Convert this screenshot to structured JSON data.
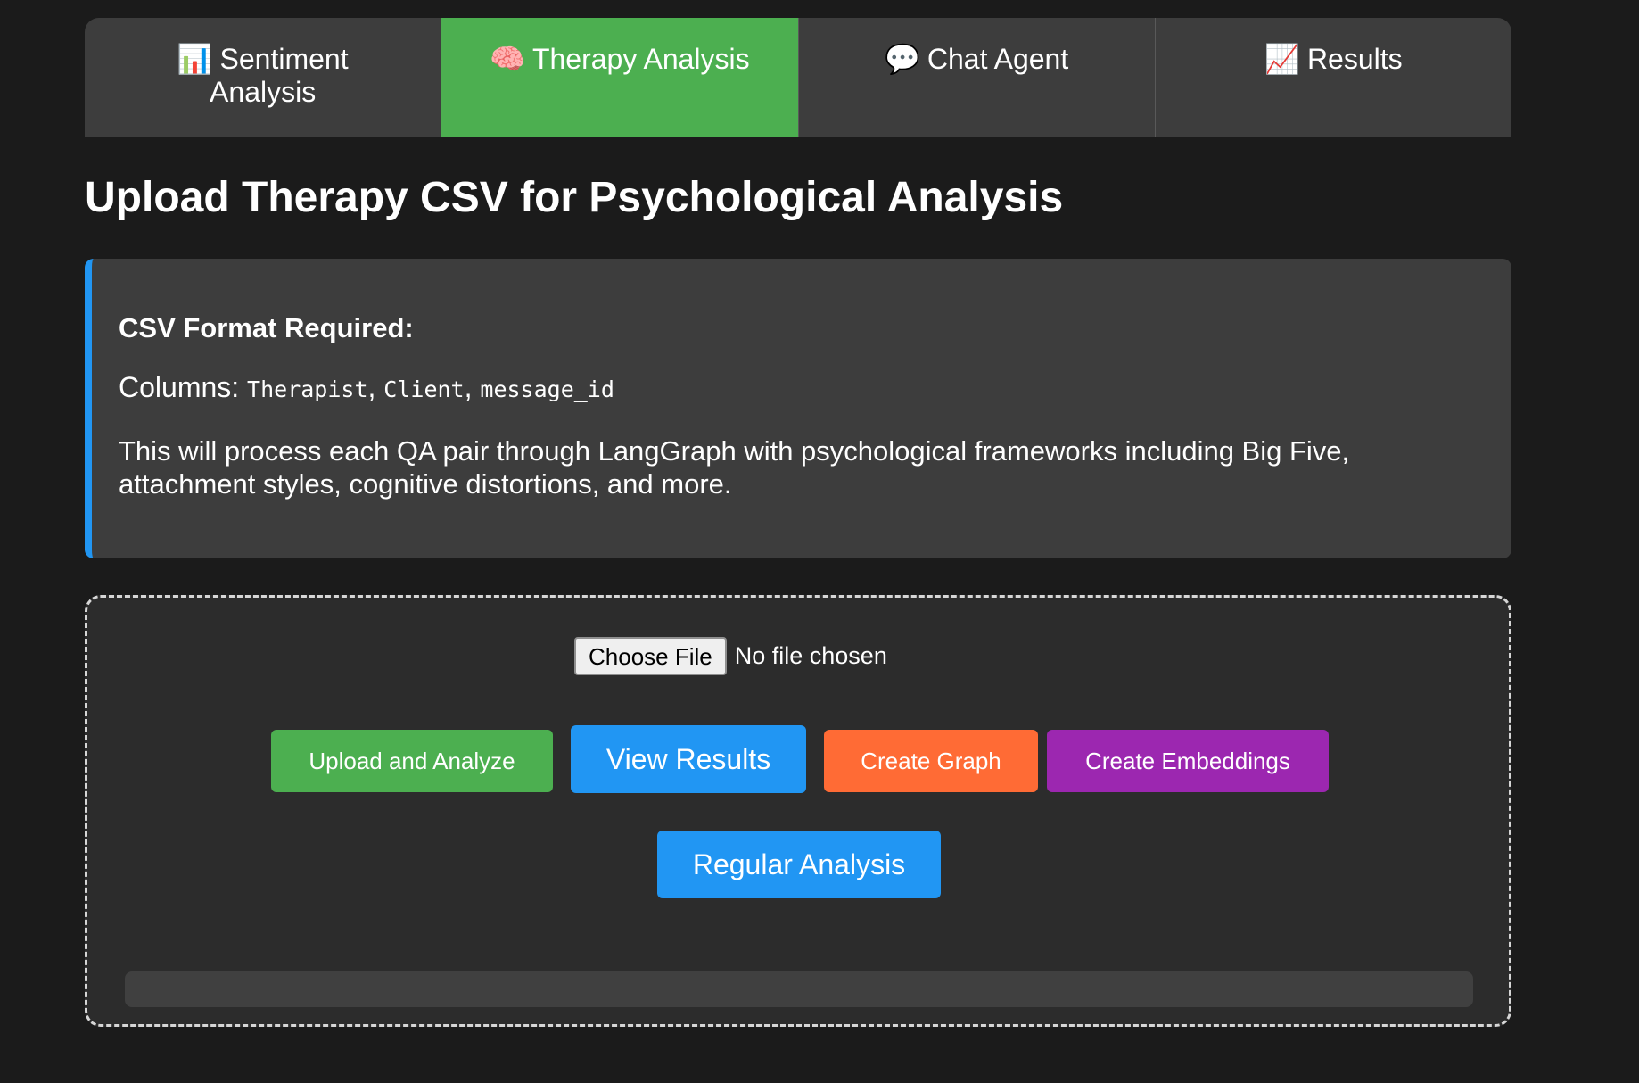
{
  "tabs": [
    {
      "emoji": "📊",
      "label": "Sentiment Analysis",
      "active": false
    },
    {
      "emoji": "🧠",
      "label": "Therapy Analysis",
      "active": true
    },
    {
      "emoji": "💬",
      "label": "Chat Agent",
      "active": false
    },
    {
      "emoji": "📈",
      "label": "Results",
      "active": false
    }
  ],
  "page_title": "Upload Therapy CSV for Psychological Analysis",
  "info": {
    "heading": "CSV Format Required:",
    "columns_prefix": "Columns: ",
    "columns": [
      "Therapist",
      "Client",
      "message_id"
    ],
    "description": "This will process each QA pair through LangGraph with psychological frameworks including Big Five, attachment styles, cognitive distortions, and more."
  },
  "upload": {
    "choose_file_label": "Choose File",
    "file_status": "No file chosen",
    "buttons": {
      "upload_analyze": "Upload and Analyze",
      "view_results": "View Results",
      "create_graph": "Create Graph",
      "create_embeddings": "Create Embeddings",
      "regular_analysis": "Regular Analysis"
    }
  },
  "progress": 0,
  "colors": {
    "background": "#1b1b1b",
    "panel": "#3d3d3d",
    "active_tab": "#4caf50",
    "info_accent": "#2196f3",
    "upload_btn": "#4caf50",
    "view_btn": "#2196f3",
    "graph_btn": "#ff6b35",
    "embed_btn": "#9c27b0"
  }
}
